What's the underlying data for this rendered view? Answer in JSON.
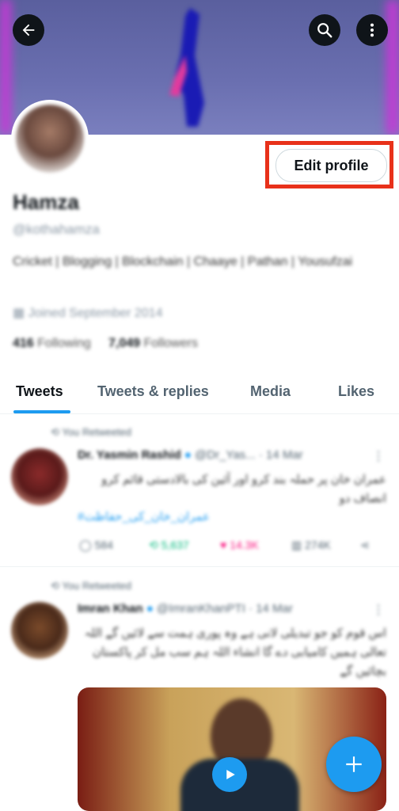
{
  "header": {
    "back_icon": "arrow-left-icon",
    "search_icon": "search-icon",
    "more_icon": "more-vertical-icon"
  },
  "profile": {
    "edit_label": "Edit profile",
    "name": "Hamza",
    "handle": "@kothahamza",
    "bio": "Cricket | Blogging | Blockchain | Chaaye | Pathan | Yousufzai",
    "joined": "Joined September 2014",
    "following_count": "416",
    "following_label": "Following",
    "followers_count": "7,049",
    "followers_label": "Followers"
  },
  "tabs": [
    {
      "label": "Tweets"
    },
    {
      "label": "Tweets & replies"
    },
    {
      "label": "Media"
    },
    {
      "label": "Likes"
    }
  ],
  "tweets": [
    {
      "retweet_label": "You Retweeted",
      "author": "Dr. Yasmin Rashid",
      "meta": "@Dr_Yas... · 14 Mar",
      "body": "عمران خان پر حملہ بند کرو اور آئین کی بالادستی قائم کرو انصاف دو",
      "link": "#عمران_خان_کی_حفاظت",
      "reply_count": "584",
      "retweet_count": "5,637",
      "like_count": "14.3K",
      "views_count": "274K"
    },
    {
      "retweet_label": "You Retweeted",
      "author": "Imran Khan",
      "meta": "@ImranKhanPTI · 14 Mar",
      "body": "اس قوم کو جو تبدیلی لانی ہے وہ پوری ہمت سے لائیں گے اللہ تعالی ہمیں کامیابی دے گا انشاء اللہ ہم سب مل کر پاکستان بچائیں گے"
    }
  ],
  "colors": {
    "accent": "#1d9bf0",
    "highlight": "#e8311a",
    "like": "#f91880",
    "retweet": "#00ba7c"
  }
}
